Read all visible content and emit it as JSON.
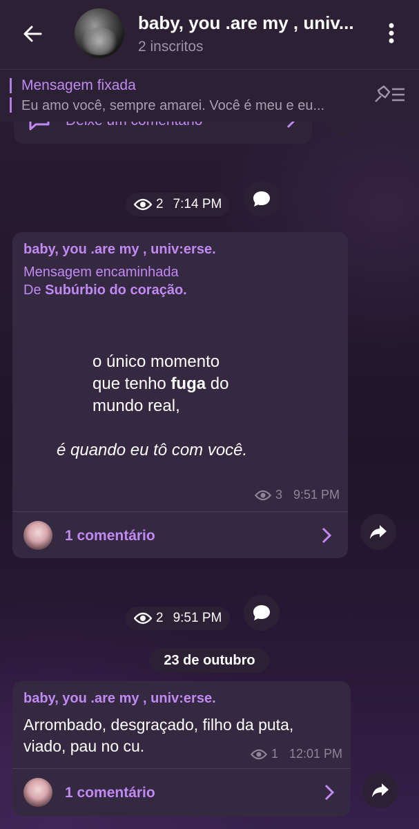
{
  "header": {
    "title": "baby, you .are my , univ...",
    "subtitle": "2 inscritos",
    "back_icon": "arrow-left-icon",
    "menu_icon": "more-vert-icon"
  },
  "pinned": {
    "title": "Mensagem fixada",
    "text": "Eu amo você, sempre amarei. Você é meu e eu...",
    "icon": "pin-list-icon"
  },
  "previous_post": {
    "comment_label": "Deixe um comentário"
  },
  "meta_1": {
    "views": "2",
    "time": "7:14 PM"
  },
  "post_1": {
    "sender": "baby, you .are my , univ:erse.",
    "forwarded_label": "Mensagem encaminhada",
    "from_prefix": "De",
    "from_source": "Subúrbio do coração.",
    "line1": "o único momento",
    "line2_pre": "que tenho ",
    "line2_bold": "fuga",
    "line2_post": " do",
    "line3": "mundo real,",
    "line4": "é quando eu tô com você.",
    "views": "3",
    "time": "9:51 PM",
    "comments": "1 comentário"
  },
  "meta_2": {
    "views": "2",
    "time": "9:51 PM"
  },
  "date_separator": "23 de outubro",
  "post_2": {
    "sender": "baby, you .are my , univ:erse.",
    "text_line1": "Arrombado, desgraçado, filho da puta,",
    "text_line2": "viado, pau no cu.",
    "views": "1",
    "time": "12:01 PM",
    "comments": "1 comentário"
  },
  "colors": {
    "accent": "#c08af2",
    "bubble": "#342940",
    "bar": "#2c2134"
  }
}
